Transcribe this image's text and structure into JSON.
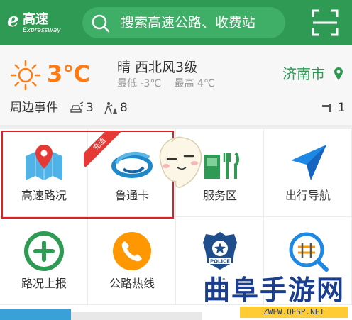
{
  "header": {
    "logo": {
      "letter": "e",
      "cn": "高速",
      "en": "Expressway"
    },
    "search_placeholder": "搜索高速公路、收费站"
  },
  "weather": {
    "temperature": "3℃",
    "condition": "晴 西北风3级",
    "low": "最低 -3℃",
    "high": "最高 4℃",
    "city": "济南市"
  },
  "events": {
    "label": "周边事件",
    "accidents": "3",
    "construction": "8",
    "right_count": "1"
  },
  "grid": {
    "items": [
      {
        "label": "高速路况",
        "icon": "map-pin-icon"
      },
      {
        "label": "鲁通卡",
        "icon": "lutong-card-icon",
        "badge": "充值"
      },
      {
        "label": "服务区",
        "icon": "service-area-icon"
      },
      {
        "label": "出行导航",
        "icon": "navigation-arrow-icon"
      },
      {
        "label": "路况上报",
        "icon": "report-plus-icon"
      },
      {
        "label": "公路热线",
        "icon": "phone-icon"
      },
      {
        "label": "事",
        "icon": "police-badge-icon",
        "badge_text": "POLICE"
      },
      {
        "label": "",
        "icon": "road-search-icon"
      }
    ]
  },
  "watermark": {
    "title": "曲阜手游网",
    "url": "ZWFW.QFSP.NET"
  },
  "colors": {
    "brand_green": "#2e9a54",
    "temperature_orange": "#ff7a10",
    "highlight_red": "#e02020"
  }
}
